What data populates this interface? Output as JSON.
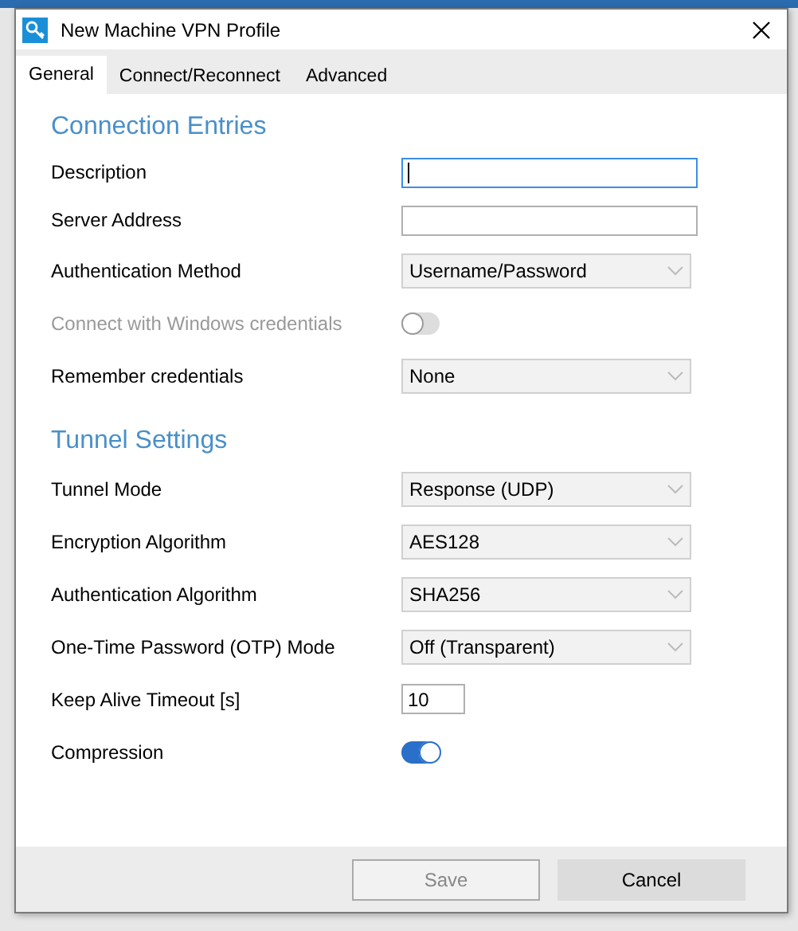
{
  "window": {
    "title": "New Machine VPN Profile"
  },
  "tabs": [
    {
      "label": "General",
      "selected": true
    },
    {
      "label": "Connect/Reconnect",
      "selected": false
    },
    {
      "label": "Advanced",
      "selected": false
    }
  ],
  "sections": [
    {
      "title": "Connection Entries",
      "rows": [
        {
          "kind": "text",
          "label": "Description",
          "focused": true,
          "disabled": false
        },
        {
          "kind": "text",
          "label": "Server Address",
          "focused": false,
          "disabled": false
        },
        {
          "kind": "select",
          "label": "Authentication Method",
          "value": "Username/Password",
          "disabled": false
        },
        {
          "kind": "toggle",
          "label": "Connect with Windows credentials",
          "on": false,
          "disabled": true
        },
        {
          "kind": "select",
          "label": "Remember credentials",
          "value": "None",
          "disabled": false
        }
      ]
    },
    {
      "title": "Tunnel Settings",
      "rows": [
        {
          "kind": "select",
          "label": "Tunnel Mode",
          "value": "Response (UDP)",
          "disabled": false
        },
        {
          "kind": "select",
          "label": "Encryption Algorithm",
          "value": "AES128",
          "disabled": false
        },
        {
          "kind": "select",
          "label": "Authentication Algorithm",
          "value": "SHA256",
          "disabled": false
        },
        {
          "kind": "select",
          "label": "One-Time Password (OTP) Mode",
          "value": "Off (Transparent)",
          "disabled": false
        },
        {
          "kind": "short",
          "label": "Keep Alive Timeout [s]",
          "value": "10",
          "focused": false,
          "disabled": false
        },
        {
          "kind": "toggle",
          "label": "Compression",
          "on": true,
          "disabled": false
        }
      ]
    }
  ],
  "buttons": [
    {
      "label": "Save",
      "disabled": true
    },
    {
      "label": "Cancel",
      "disabled": false
    }
  ]
}
